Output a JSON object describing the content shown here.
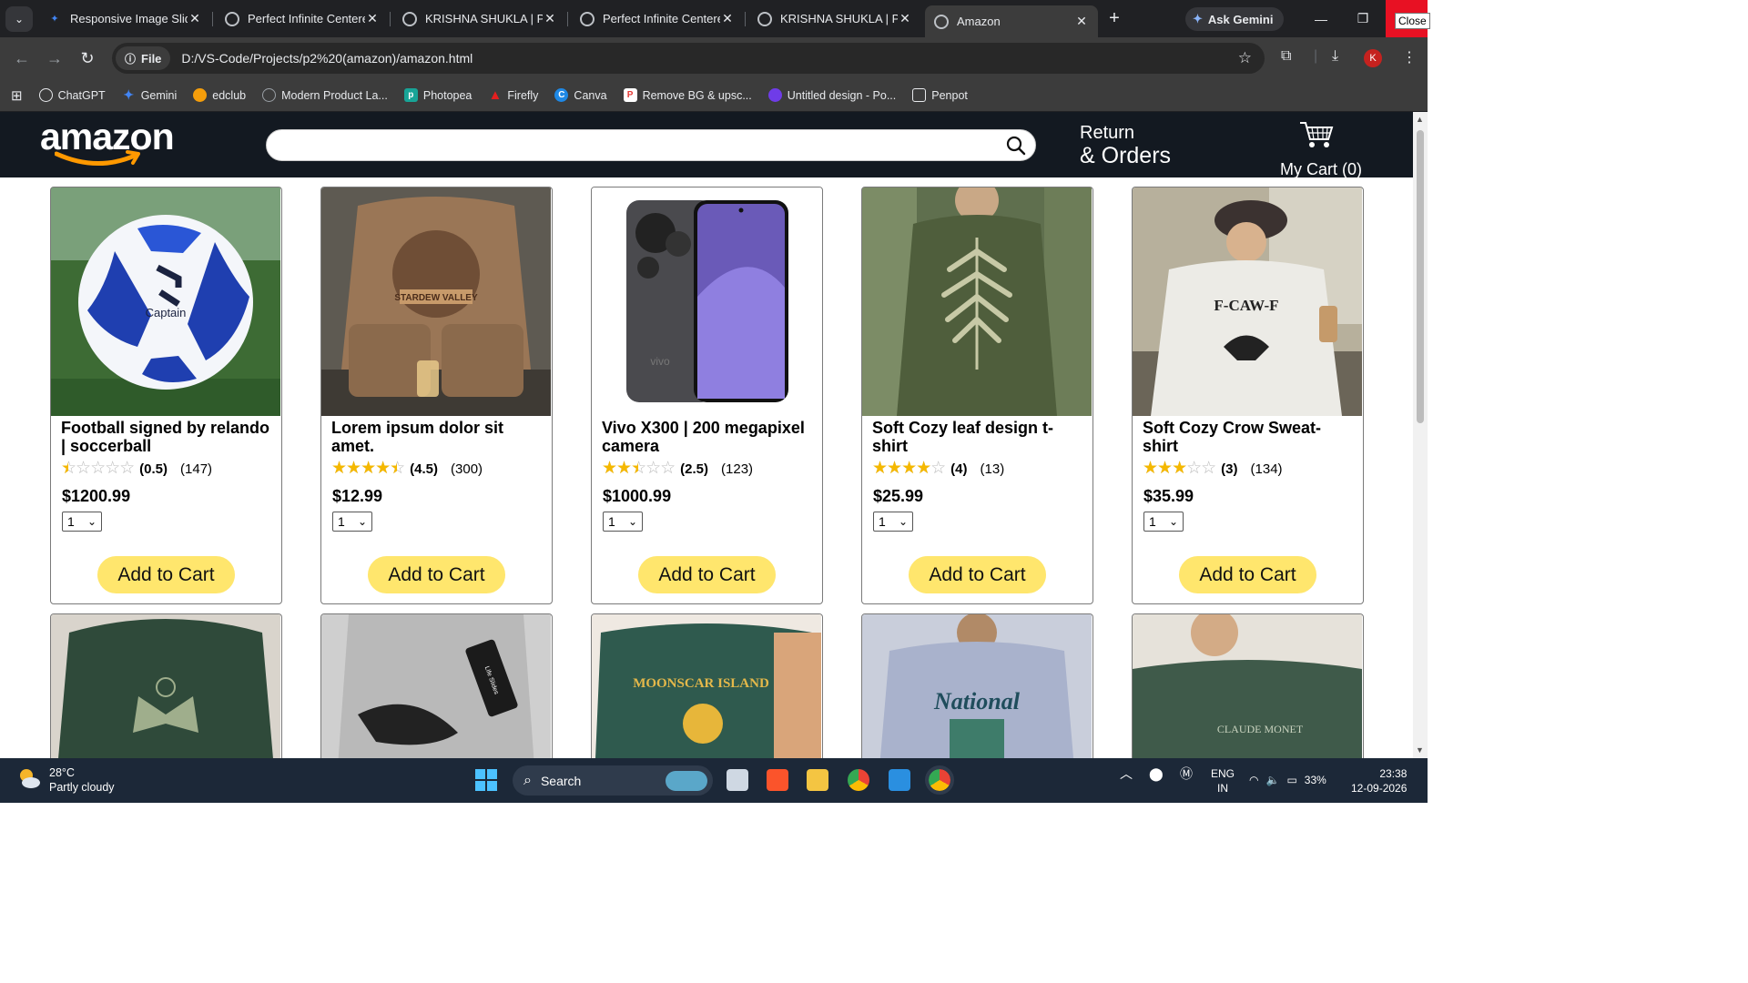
{
  "browser": {
    "tabs": [
      {
        "title": "Responsive Image Slide",
        "icon": "gemini-icon"
      },
      {
        "title": "Perfect Infinite Centere",
        "icon": "globe-icon"
      },
      {
        "title": "KRISHNA SHUKLA | Por",
        "icon": "globe-icon"
      },
      {
        "title": "Perfect Infinite Centere",
        "icon": "globe-icon"
      },
      {
        "title": "KRISHNA SHUKLA | Por",
        "icon": "globe-icon"
      },
      {
        "title": "Amazon",
        "icon": "globe-icon"
      }
    ],
    "ask_gemini": "Ask Gemini",
    "close_tooltip": "Close",
    "file_chip": "File",
    "url": "D:/VS-Code/Projects/p2%20(amazon)/amazon.html",
    "profile_initial": "K",
    "bookmarks": [
      {
        "label": "ChatGPT",
        "icon": "chatgpt-icon",
        "color": "#e8eaed"
      },
      {
        "label": "Gemini",
        "icon": "gemini-icon",
        "color": "#4285f4"
      },
      {
        "label": "edclub",
        "icon": "edclub-icon",
        "color": "#f59e0b"
      },
      {
        "label": "Modern Product La...",
        "icon": "globe-icon",
        "color": "#9aa0a6"
      },
      {
        "label": "Photopea",
        "icon": "photopea-icon",
        "color": "#18a497"
      },
      {
        "label": "Firefly",
        "icon": "adobe-icon",
        "color": "#e41f1f"
      },
      {
        "label": "Canva",
        "icon": "canva-icon",
        "color": "#1e88e5"
      },
      {
        "label": "Remove BG & upsc...",
        "icon": "pixelcut-icon",
        "color": "#e53935"
      },
      {
        "label": "Untitled design - Po...",
        "icon": "penpot-icon",
        "color": "#6f3ce8"
      },
      {
        "label": "Penpot",
        "icon": "penpot-icon",
        "color": "#e8eaed"
      }
    ]
  },
  "header": {
    "logo": "amazon",
    "search_placeholder": "",
    "returns_line1": "Return",
    "returns_line2": "& Orders",
    "cart_label": "My Cart (0)"
  },
  "products": [
    {
      "name": "Football signed by relando | soccerball",
      "rating": 0.5,
      "rating_text": "(0.5)",
      "count": "(147)",
      "price": "$1200.99",
      "qty": "1",
      "button": "Add to Cart"
    },
    {
      "name": "Lorem ipsum dolor sit amet.",
      "rating": 4.5,
      "rating_text": "(4.5)",
      "count": "(300)",
      "price": "$12.99",
      "qty": "1",
      "button": "Add to Cart"
    },
    {
      "name": "Vivo X300 | 200 megapixel camera",
      "rating": 2.5,
      "rating_text": "(2.5)",
      "count": "(123)",
      "price": "$1000.99",
      "qty": "1",
      "button": "Add to Cart"
    },
    {
      "name": "Soft Cozy leaf design t-shirt",
      "rating": 4,
      "rating_text": "(4)",
      "count": "(13)",
      "price": "$25.99",
      "qty": "1",
      "button": "Add to Cart"
    },
    {
      "name": "Soft Cozy Crow Sweat-shirt",
      "rating": 3,
      "rating_text": "(3)",
      "count": "(134)",
      "price": "$35.99",
      "qty": "1",
      "button": "Add to Cart"
    }
  ],
  "images_text": {
    "ball_brand": "Captain",
    "tshirt_print": "STARDEW VALLEY",
    "phone_brand": "vivo",
    "crow_print": "F-CAW-F",
    "row2_a_print": "",
    "row2_b_tag": "Life Slides",
    "row2_c_print": "MOONSCAR ISLAND",
    "row2_d_print": "National",
    "row2_e_print": "CLAUDE MONET"
  },
  "taskbar": {
    "temp": "28°C",
    "weather": "Partly cloudy",
    "search": "Search",
    "lang1": "ENG",
    "lang2": "IN",
    "battery": "33%",
    "time": "23:38",
    "date": "12-09-2026"
  },
  "colors": {
    "accent_button": "#ffe66d",
    "header_bg": "#131921",
    "star": "#f5b800"
  }
}
